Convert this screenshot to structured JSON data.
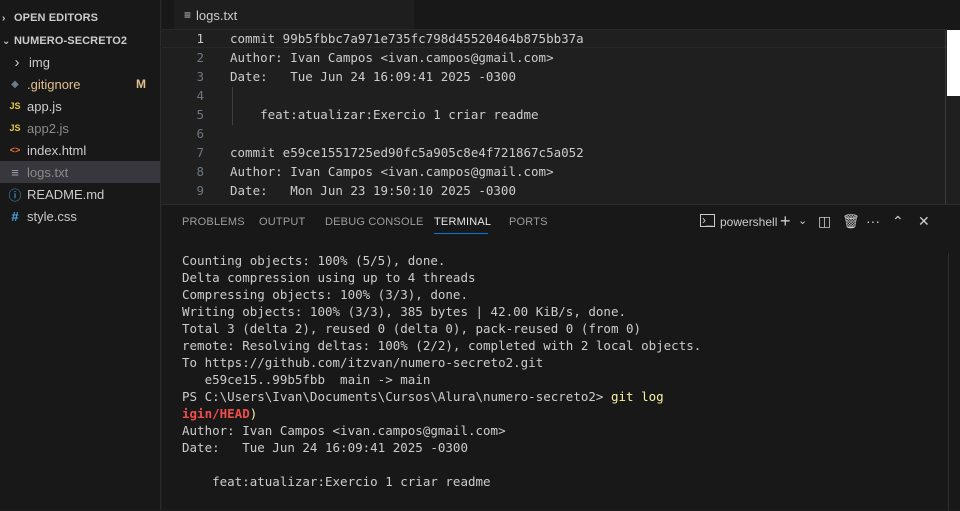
{
  "sidebar": {
    "open_editors_label": "OPEN EDITORS",
    "project_label": "NUMERO-SECRETO2",
    "items": [
      {
        "label": "img",
        "icon": "chevron-right-icon",
        "glyph": "›",
        "color": "#cccccc"
      },
      {
        "label": ".gitignore",
        "icon": "gitignore-icon",
        "glyph": "◆",
        "color": "#6b7a8c",
        "badge": "M"
      },
      {
        "label": "app.js",
        "icon": "js-file-icon",
        "glyph": "JS",
        "color": "#e8c84a"
      },
      {
        "label": "app2.js",
        "icon": "js-file-icon",
        "glyph": "JS",
        "color": "#e8c84a"
      },
      {
        "label": "index.html",
        "icon": "html-file-icon",
        "glyph": "<>",
        "color": "#e8703a"
      },
      {
        "label": "logs.txt",
        "icon": "text-file-icon",
        "glyph": "≡",
        "color": "#9da5b4"
      },
      {
        "label": "README.md",
        "icon": "info-icon",
        "glyph": "ⓘ",
        "color": "#4aa8e8"
      },
      {
        "label": "style.css",
        "icon": "css-file-icon",
        "glyph": "#",
        "color": "#4aa8e8"
      }
    ]
  },
  "editor": {
    "tab_label": "logs.txt",
    "lines": [
      {
        "n": "1",
        "text": "commit 99b5fbbc7a971e735fc798d45520464b875bb37a"
      },
      {
        "n": "2",
        "text": "Author: Ivan Campos <ivan.campos@gmail.com>"
      },
      {
        "n": "3",
        "text": "Date:   Tue Jun 24 16:09:41 2025 -0300"
      },
      {
        "n": "4",
        "text": ""
      },
      {
        "n": "5",
        "text": "    feat:atualizar:Exercio 1 criar readme"
      },
      {
        "n": "6",
        "text": ""
      },
      {
        "n": "7",
        "text": "commit e59ce1551725ed90fc5a905c8e4f721867c5a052"
      },
      {
        "n": "8",
        "text": "Author: Ivan Campos <ivan.campos@gmail.com>"
      },
      {
        "n": "9",
        "text": "Date:   Mon Jun 23 19:50:10 2025 -0300"
      }
    ]
  },
  "panel": {
    "tabs": [
      "PROBLEMS",
      "OUTPUT",
      "DEBUG CONSOLE",
      "TERMINAL",
      "PORTS"
    ],
    "active_tab": "TERMINAL",
    "terminal_name": "powershell",
    "terminal_lines": [
      "Counting objects: 100% (5/5), done.",
      "Delta compression using up to 4 threads",
      "Compressing objects: 100% (3/3), done.",
      "Writing objects: 100% (3/3), 385 bytes | 42.00 KiB/s, done.",
      "Total 3 (delta 2), reused 0 (delta 0), pack-reused 0 (from 0)",
      "remote: Resolving deltas: 100% (2/2), completed with 2 local objects.",
      "To https://github.com/itzvan/numero-secreto2.git",
      "   e59ce15..99b5fbb  main -> main"
    ],
    "prompt": "PS C:\\Users\\Ivan\\Documents\\Cursos\\Alura\\numero-secreto2> ",
    "command": "git log",
    "head_fragment": "igin/HEAD",
    "head_close": ")",
    "after_lines": [
      "Author: Ivan Campos <ivan.campos@gmail.com>",
      "Date:   Tue Jun 24 16:09:41 2025 -0300",
      "",
      "    feat:atualizar:Exercio 1 criar readme"
    ]
  }
}
